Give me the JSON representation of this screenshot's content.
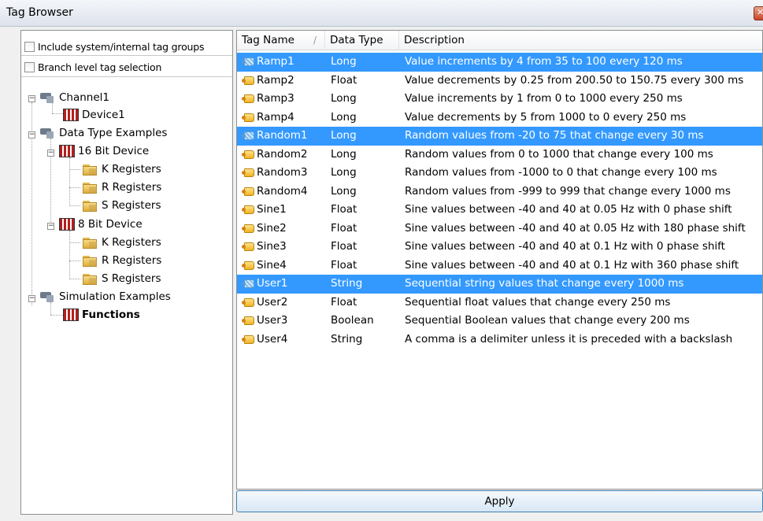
{
  "window": {
    "title": "Tag Browser"
  },
  "options": {
    "include_system": "Include system/internal tag groups",
    "branch_level": "Branch level tag selection"
  },
  "tree": {
    "channel1": "Channel1",
    "device1": "Device1",
    "data_type_examples": "Data Type Examples",
    "bit16_device": "16 Bit Device",
    "bit16_k": "K Registers",
    "bit16_r": "R Registers",
    "bit16_s": "S Registers",
    "bit8_device": "8 Bit Device",
    "bit8_k": "K Registers",
    "bit8_r": "R Registers",
    "bit8_s": "S Registers",
    "simulation_examples": "Simulation Examples",
    "functions": "Functions"
  },
  "table": {
    "columns": {
      "tag_name": "Tag Name",
      "data_type": "Data Type",
      "description": "Description"
    },
    "rows": [
      {
        "name": "Ramp1",
        "type": "Long",
        "desc": "Value increments by 4 from 35 to 100 every 120  ms",
        "selected": true
      },
      {
        "name": "Ramp2",
        "type": "Float",
        "desc": "Value decrements by 0.25 from 200.50 to 150.75 every 300 ms",
        "selected": false
      },
      {
        "name": "Ramp3",
        "type": "Long",
        "desc": "Value increments by 1 from 0 to 1000 every 250  ms",
        "selected": false
      },
      {
        "name": "Ramp4",
        "type": "Long",
        "desc": "Value decrements by 5 from 1000 to 0 every 250  ms",
        "selected": false
      },
      {
        "name": "Random1",
        "type": "Long",
        "desc": "Random values from -20 to 75 that change every 30 ms",
        "selected": true
      },
      {
        "name": "Random2",
        "type": "Long",
        "desc": "Random values from 0 to 1000 that change every 100 ms",
        "selected": false
      },
      {
        "name": "Random3",
        "type": "Long",
        "desc": "Random values from -1000 to 0 that change every 100 ms",
        "selected": false
      },
      {
        "name": "Random4",
        "type": "Long",
        "desc": "Random values from -999 to 999 that change every 1000 ms",
        "selected": false
      },
      {
        "name": "Sine1",
        "type": "Float",
        "desc": "Sine values between -40 and 40 at 0.05 Hz with 0 phase shift",
        "selected": false
      },
      {
        "name": "Sine2",
        "type": "Float",
        "desc": "Sine values between -40 and 40 at 0.05 Hz with 180 phase shift",
        "selected": false
      },
      {
        "name": "Sine3",
        "type": "Float",
        "desc": "Sine values between -40 and 40 at 0.1 Hz with 0 phase shift",
        "selected": false
      },
      {
        "name": "Sine4",
        "type": "Float",
        "desc": "Sine values between -40 and 40 at 0.1 Hz with 360 phase shift",
        "selected": false
      },
      {
        "name": "User1",
        "type": "String",
        "desc": "Sequential string values that change every 1000 ms",
        "selected": true
      },
      {
        "name": "User2",
        "type": "Float",
        "desc": "Sequential float values that change every 250 ms",
        "selected": false
      },
      {
        "name": "User3",
        "type": "Boolean",
        "desc": "Sequential Boolean values that change every 200 ms",
        "selected": false
      },
      {
        "name": "User4",
        "type": "String",
        "desc": "A comma is a delimiter unless it is preceded with a backslash",
        "selected": false
      }
    ]
  },
  "buttons": {
    "apply": "Apply"
  },
  "colors": {
    "selection": "#3399ff",
    "button_border": "#3c7fb1"
  }
}
